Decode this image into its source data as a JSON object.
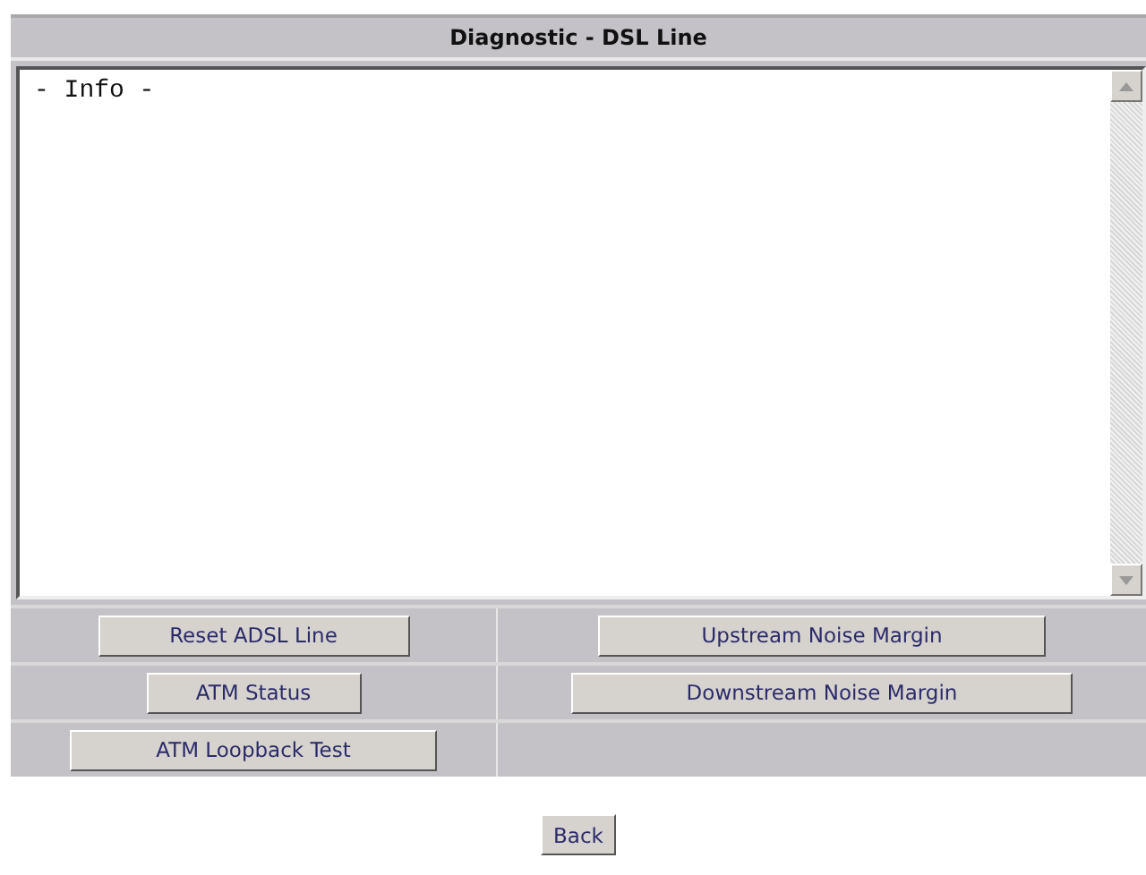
{
  "title": "Diagnostic - DSL Line",
  "info": {
    "value": "- Info -"
  },
  "button_rows": [
    [
      "Reset ADSL Line",
      "Upstream Noise Margin"
    ],
    [
      "ATM Status",
      "Downstream Noise Margin"
    ],
    [
      "ATM Loopback Test"
    ]
  ],
  "back_button": "Back"
}
